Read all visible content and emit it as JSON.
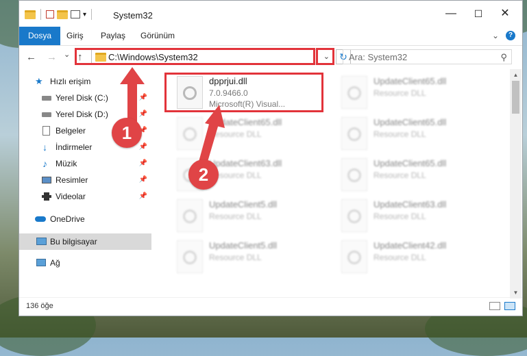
{
  "window": {
    "title": "System32",
    "controls": {
      "minimize": "—",
      "maximize": "☐",
      "close": "✕"
    }
  },
  "ribbon": {
    "tabs": [
      "Dosya",
      "Giriş",
      "Paylaş",
      "Görünüm"
    ],
    "expand_icon": "chevron-down",
    "help_label": "?"
  },
  "navigation": {
    "back": "←",
    "forward": "→",
    "recent": "⌄",
    "up": "↑",
    "address": "C:\\Windows\\System32",
    "address_dropdown": "⌄",
    "refresh": "↻",
    "search_placeholder": "Ara: System32",
    "search_icon": "⚲"
  },
  "sidebar": {
    "items": [
      {
        "label": "Hızlı erişim",
        "icon": "star-icon",
        "pinned": false
      },
      {
        "label": "Yerel Disk (C:)",
        "icon": "drive-icon",
        "pinned": true
      },
      {
        "label": "Yerel Disk (D:)",
        "icon": "drive-icon",
        "pinned": true
      },
      {
        "label": "Belgeler",
        "icon": "documents-icon",
        "pinned": true
      },
      {
        "label": "İndirmeler",
        "icon": "download-icon",
        "pinned": true
      },
      {
        "label": "Müzik",
        "icon": "music-icon",
        "pinned": true
      },
      {
        "label": "Resimler",
        "icon": "pictures-icon",
        "pinned": true
      },
      {
        "label": "Videolar",
        "icon": "videos-icon",
        "pinned": true
      },
      {
        "label": "OneDrive",
        "icon": "cloud-icon",
        "pinned": false
      },
      {
        "label": "Bu bilgisayar",
        "icon": "computer-icon",
        "pinned": false,
        "selected": true
      },
      {
        "label": "Ağ",
        "icon": "network-icon",
        "pinned": false
      }
    ],
    "pin_glyph": "📌"
  },
  "files": [
    {
      "name": "dpprjui.dll",
      "line2": "7.0.9466.0",
      "line3": "Microsoft(R) Visual...",
      "highlighted": true
    },
    {
      "name": "UpdateClient65.dll",
      "line2": "Resource DLL"
    },
    {
      "name": "UpdateClient65.dll",
      "line2": "Resource DLL"
    },
    {
      "name": "UpdateClient65.dll",
      "line2": "Resource DLL"
    },
    {
      "name": "UpdateClient63.dll",
      "line2": "Resource DLL"
    },
    {
      "name": "UpdateClient65.dll",
      "line2": "Resource DLL"
    },
    {
      "name": "UpdateClient5.dll",
      "line2": "Resource DLL"
    },
    {
      "name": "UpdateClient63.dll",
      "line2": "Resource DLL"
    },
    {
      "name": "UpdateClient5.dll",
      "line2": "Resource DLL"
    },
    {
      "name": "UpdateClient42.dll",
      "line2": "Resource DLL"
    }
  ],
  "status": {
    "item_count": "136 öğe"
  },
  "markers": {
    "one": "1",
    "two": "2"
  },
  "colors": {
    "accent": "#1979ca",
    "highlight": "#e2333a",
    "marker": "#e04446"
  }
}
